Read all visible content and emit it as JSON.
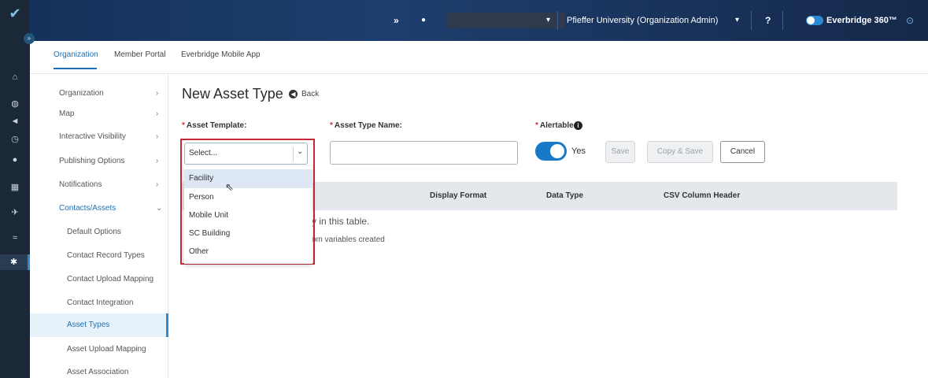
{
  "rail": {
    "logo": "✔",
    "expand": "»",
    "icons": [
      "home-icon",
      "dashboard-icon",
      "megaphone-icon",
      "clock-icon",
      "location-icon",
      "calendar-icon",
      "plane-icon",
      "signal-icon",
      "gear-icon"
    ]
  },
  "topbar": {
    "expand_glyph": "»",
    "user_glyph": "●",
    "user_caret": "▾",
    "org_label": "Pfieffer University (Organization Admin)",
    "org_caret": "▾",
    "help_glyph": "?",
    "product_label": "Everbridge 360™",
    "product_glyph": "⊙"
  },
  "tabs": [
    {
      "label": "Organization",
      "active": true
    },
    {
      "label": "Member Portal",
      "active": false
    },
    {
      "label": "Everbridge Mobile App",
      "active": false
    }
  ],
  "sidebar": [
    {
      "label": "Organization",
      "chevron": "›"
    },
    {
      "label": "Map",
      "chevron": "›"
    },
    {
      "label": "Interactive Visibility",
      "chevron": "›"
    },
    {
      "label": "Publishing Options",
      "chevron": "›"
    },
    {
      "label": "Notifications",
      "chevron": "›"
    },
    {
      "label": "Contacts/Assets",
      "chevron": "⌄"
    },
    {
      "label": "Default Options"
    },
    {
      "label": "Contact Record Types"
    },
    {
      "label": "Contact Upload Mapping"
    },
    {
      "label": "Contact Integration"
    },
    {
      "label": "Asset Types"
    },
    {
      "label": "Asset Upload Mapping"
    },
    {
      "label": "Asset Association"
    }
  ],
  "page": {
    "title": "New Asset Type",
    "back_label": "Back",
    "back_glyph": "◀"
  },
  "form": {
    "required_mark": "*",
    "template_label": "Asset Template:",
    "template_value": "Select...",
    "template_chevron": "⌄",
    "name_label": "Asset Type Name:",
    "name_value": "",
    "alertable_label": "Alertable",
    "info_glyph": "i",
    "alertable_value": "Yes",
    "save_label": "Save",
    "copy_save_label": "Copy & Save",
    "cancel_label": "Cancel"
  },
  "table": {
    "columns": [
      "Display Format",
      "Data Type",
      "CSV Column Header"
    ],
    "empty_line1": "y in this table.",
    "empty_line2": "om variables created"
  },
  "dropdown": {
    "options": [
      "Facility",
      "Person",
      "Mobile Unit",
      "SC Building",
      "Other"
    ],
    "hovered": "Facility",
    "cursor_glyph": "⇖"
  },
  "colors": {
    "accent": "#1e6fb5",
    "highlight_border": "#c62838",
    "rail": "#1b2838",
    "topbar": "#1d3e6e"
  }
}
